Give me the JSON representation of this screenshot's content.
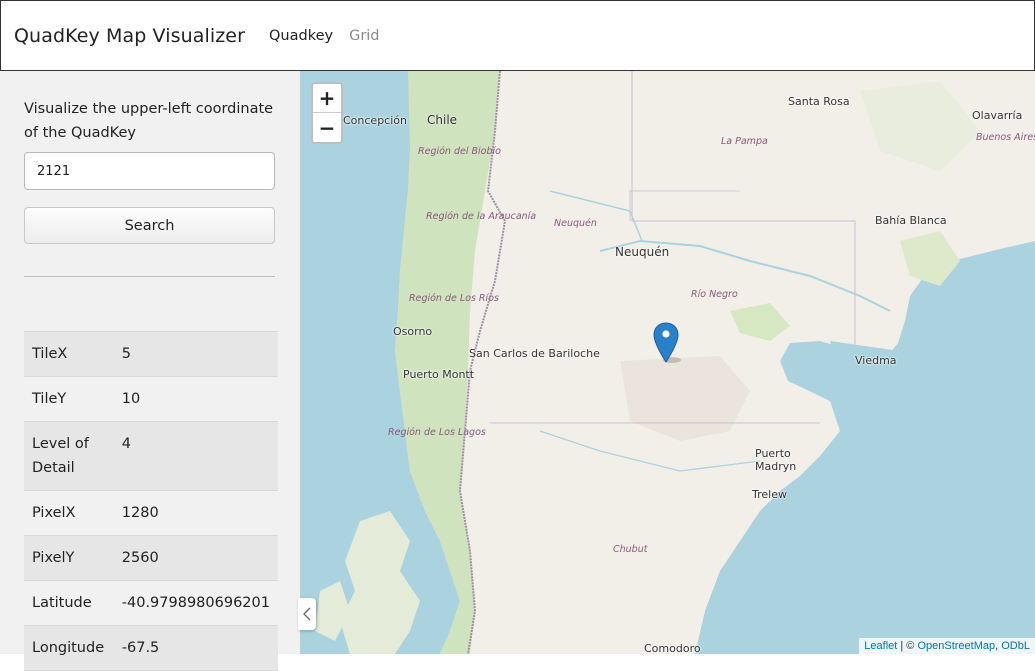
{
  "navbar": {
    "brand": "QuadKey Map Visualizer",
    "links": [
      "Quadkey",
      "Grid"
    ]
  },
  "sidebar": {
    "label": "Visualize the upper-left coordinate of the QuadKey",
    "input_value": "2121",
    "search_label": "Search",
    "collapse_icon": "chevron-left-icon",
    "rows": [
      {
        "key": "TileX",
        "value": "5"
      },
      {
        "key": "TileY",
        "value": "10"
      },
      {
        "key": "Level of Detail",
        "value": "4"
      },
      {
        "key": "PixelX",
        "value": "1280"
      },
      {
        "key": "PixelY",
        "value": "2560"
      },
      {
        "key": "Latitude",
        "value": "-40.9798980696201"
      },
      {
        "key": "Longitude",
        "value": "-67.5"
      }
    ]
  },
  "map": {
    "zoom_in": "+",
    "zoom_out": "−",
    "marker_icon": "map-pin-icon",
    "marker_color": "#2a81cb",
    "places": {
      "concepcion": "Concepción",
      "chile": "Chile",
      "region_biobio": "Región del Biobío",
      "region_araucania": "Región de la Araucanía",
      "region_rios": "Región de Los Ríos",
      "osorno": "Osorno",
      "puerto_montt": "Puerto Montt",
      "region_lagos": "Región de Los Lagos",
      "san_carlos": "San Carlos de Bariloche",
      "neuquen_region": "Neuquén",
      "neuquen_city": "Neuquén",
      "rio_negro": "Río Negro",
      "la_pampa": "La Pampa",
      "santa_rosa": "Santa Rosa",
      "olavarria": "Olavarría",
      "buenos_aires": "Buenos Aires",
      "bahia_blanca": "Bahía Blanca",
      "viedma": "Viedma",
      "puerto_madryn": "Puerto Madryn",
      "trelew": "Trelew",
      "chubut": "Chubut",
      "comodoro": "Comodoro"
    },
    "attribution": {
      "leaflet": "Leaflet",
      "sep": " | © ",
      "osm": "OpenStreetMap",
      "comma": ", ",
      "odbl": "ODbL"
    }
  }
}
